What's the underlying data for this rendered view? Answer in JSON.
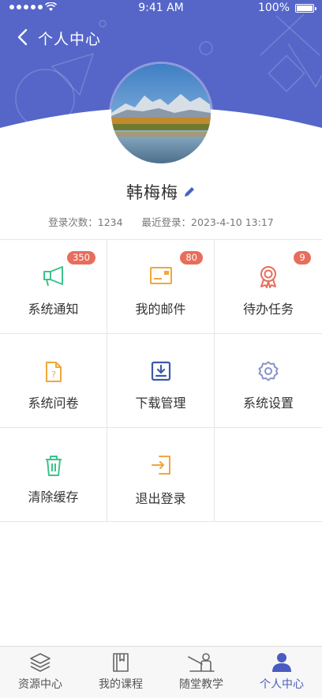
{
  "status_bar": {
    "time": "9:41 AM",
    "battery": "100%"
  },
  "header": {
    "title": "个人中心"
  },
  "profile": {
    "name": "韩梅梅",
    "login_count_label": "登录次数：1234",
    "last_login_label": "最近登录：2023-4-10 13:17"
  },
  "menu": {
    "notify": {
      "label": "系统通知",
      "badge": "350",
      "icon": "megaphone-icon",
      "color": "#3cc38c"
    },
    "mail": {
      "label": "我的邮件",
      "badge": "80",
      "icon": "mail-card-icon",
      "color": "#f0a73b"
    },
    "todo": {
      "label": "待办任务",
      "badge": "9",
      "icon": "award-ribbon-icon",
      "color": "#e86d5c"
    },
    "survey": {
      "label": "系统问卷",
      "icon": "question-doc-icon",
      "color": "#f0a73b"
    },
    "download": {
      "label": "下载管理",
      "icon": "download-icon",
      "color": "#3d5aa8"
    },
    "settings": {
      "label": "系统设置",
      "icon": "gear-icon",
      "color": "#8a94c8"
    },
    "clear_cache": {
      "label": "清除缓存",
      "icon": "trash-icon",
      "color": "#3cc38c"
    },
    "logout": {
      "label": "退出登录",
      "icon": "logout-icon",
      "color": "#f0a73b"
    }
  },
  "tabbar": {
    "resources": "资源中心",
    "courses": "我的课程",
    "teaching": "随堂教学",
    "profile": "个人中心",
    "active": "profile",
    "accent": "#4a5cc0"
  },
  "colors": {
    "header": "#5566c8",
    "badge": "#e86d5c"
  }
}
